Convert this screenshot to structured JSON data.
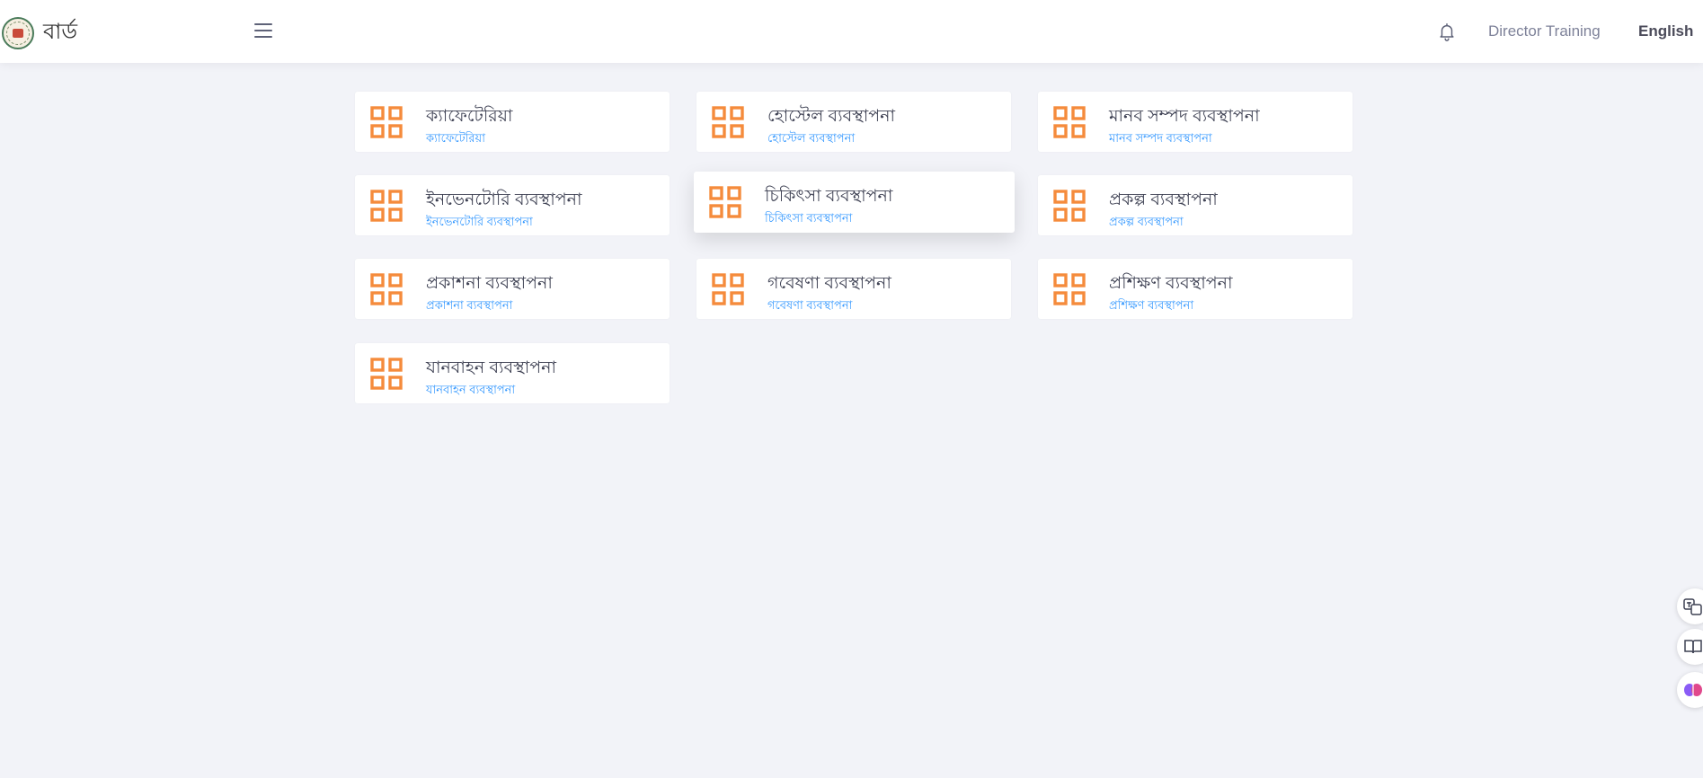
{
  "header": {
    "brand_name": "বার্ড",
    "logo_icon": "bard-emblem-icon",
    "menu_icon": "hamburger-menu-icon",
    "notification_icon": "bell-icon",
    "user_name": "Director Training",
    "language_label": "English"
  },
  "colors": {
    "accent_icon": "#f58b3c",
    "subtitle": "#3699ff",
    "background": "#f2f3f8"
  },
  "modules": [
    {
      "title": "ক্যাফেটেরিয়া",
      "subtitle": "ক্যাফেটেরিয়া",
      "icon": "apps-grid-icon"
    },
    {
      "title": "হোস্টেল ব্যবস্থাপনা",
      "subtitle": "হোস্টেল ব্যবস্থাপনা",
      "icon": "apps-grid-icon"
    },
    {
      "title": "মানব সম্পদ ব্যবস্থাপনা",
      "subtitle": "মানব সম্পদ ব্যবস্থাপনা",
      "icon": "apps-grid-icon"
    },
    {
      "title": "ইনভেনটোরি ব্যবস্থাপনা",
      "subtitle": "ইনভেনটোরি ব্যবস্থাপনা",
      "icon": "apps-grid-icon"
    },
    {
      "title": "চিকিৎসা ব্যবস্থাপনা",
      "subtitle": "চিকিৎসা ব্যবস্থাপনা",
      "icon": "apps-grid-icon"
    },
    {
      "title": "প্রকল্প ব্যবস্থাপনা",
      "subtitle": "প্রকল্প ব্যবস্থাপনা",
      "icon": "apps-grid-icon"
    },
    {
      "title": "প্রকাশনা ব্যবস্থাপনা",
      "subtitle": "প্রকাশনা ব্যবস্থাপনা",
      "icon": "apps-grid-icon"
    },
    {
      "title": "গবেষণা ব্যবস্থাপনা",
      "subtitle": "গবেষণা ব্যবস্থাপনা",
      "icon": "apps-grid-icon"
    },
    {
      "title": "প্রশিক্ষণ ব্যবস্থাপনা",
      "subtitle": "প্রশিক্ষণ ব্যবস্থাপনা",
      "icon": "apps-grid-icon"
    },
    {
      "title": "যানবাহন ব্যবস্থাপনা",
      "subtitle": "যানবাহন ব্যবস্থাপনা",
      "icon": "apps-grid-icon"
    }
  ],
  "side_tools": [
    {
      "icon": "translate-icon"
    },
    {
      "icon": "reader-book-icon"
    },
    {
      "icon": "ai-brain-icon"
    }
  ]
}
